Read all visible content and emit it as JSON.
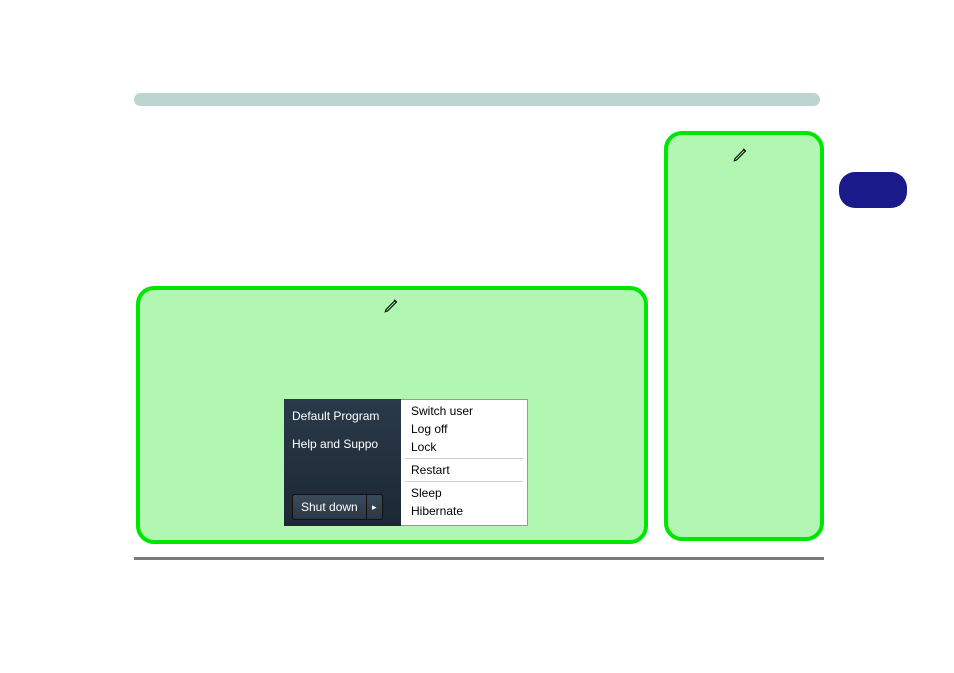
{
  "start_menu": {
    "links": [
      "Default Program",
      "Help and Suppo"
    ],
    "shutdown_label": "Shut down",
    "arrow_glyph": "▸",
    "power_menu": [
      "Switch user",
      "Log off",
      "Lock",
      "Restart",
      "Sleep",
      "Hibernate"
    ]
  }
}
